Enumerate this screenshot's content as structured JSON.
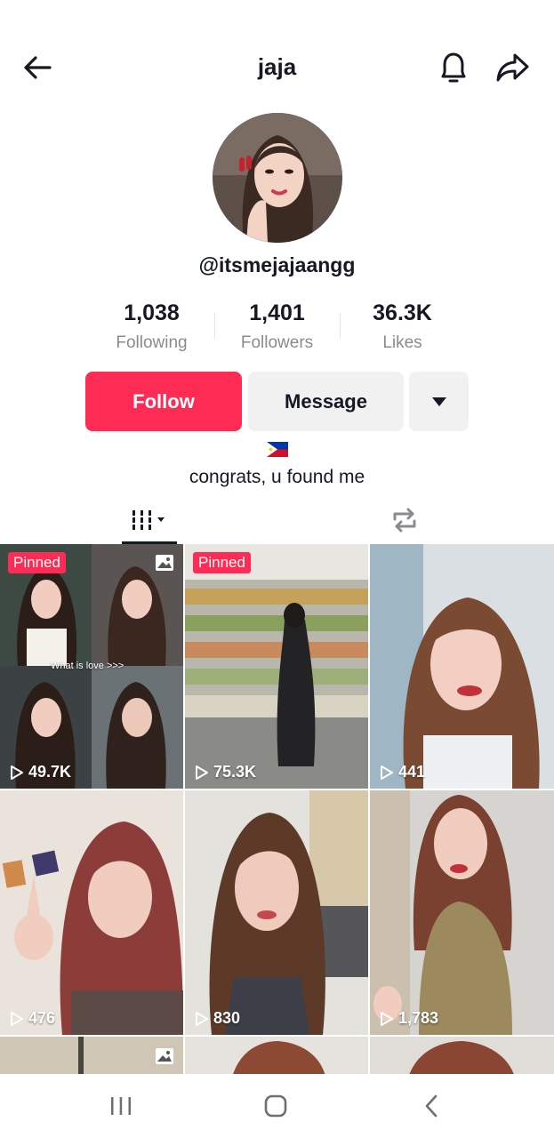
{
  "header": {
    "title": "jaja",
    "back_icon": "arrow-left-icon",
    "bell_icon": "bell-icon",
    "share_icon": "share-arrow-icon"
  },
  "profile": {
    "handle": "@itsmejajaangg",
    "flag": "🇵🇭",
    "bio": "congrats, u found me"
  },
  "stats": [
    {
      "value": "1,038",
      "label": "Following"
    },
    {
      "value": "1,401",
      "label": "Followers"
    },
    {
      "value": "36.3K",
      "label": "Likes"
    }
  ],
  "actions": {
    "follow_label": "Follow",
    "message_label": "Message",
    "more_icon": "caret-down-icon"
  },
  "tabs": {
    "videos_icon": "grid-filter-icon",
    "reposts_icon": "repost-icon"
  },
  "videos": [
    {
      "views": "49.7K",
      "pinned": "Pinned",
      "photo": true,
      "overlay": "What is love >>>"
    },
    {
      "views": "75.3K",
      "pinned": "Pinned"
    },
    {
      "views": "441"
    },
    {
      "views": "476"
    },
    {
      "views": "830"
    },
    {
      "views": "1,783"
    }
  ],
  "colors": {
    "accent": "#fe2c55",
    "text": "#161823",
    "secondary": "#8a8b91",
    "button_gray": "#f1f1f2"
  }
}
